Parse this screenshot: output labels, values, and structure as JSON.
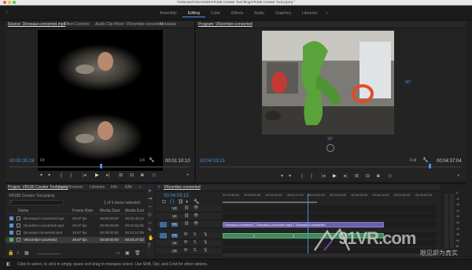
{
  "titlebar": {
    "path": "/Volumes/ASSASSIN/VR180 Creator Tool Blog/VR180 Creator Tool.prproj *"
  },
  "workspaces": [
    "Assembly",
    "Editing",
    "Color",
    "Effects",
    "Audio",
    "Graphics",
    "Libraries"
  ],
  "active_workspace": "Editing",
  "source_panel": {
    "tabs": [
      "Source: Dinosaur-converted.mp4",
      "Effect Controls",
      "Audio Clip Mixer: VRzombie-converted",
      "Metadata"
    ],
    "timecode_in": "00:00:35:26",
    "fit": "Fit",
    "timecode_dur": "00:01:10:10",
    "resolution": "1/4"
  },
  "program_panel": {
    "tab": "Program: VRzombie-converted",
    "rot_right": "90°",
    "rot_bottom": "30°",
    "timecode_in": "00:04:03:15",
    "fit": "Full",
    "timecode_dur": "00:04:37:04"
  },
  "project_panel": {
    "tabs": [
      "Project: VR180 Creator Tool.prproj",
      "Media Browser",
      "Libraries",
      "Info",
      "Effe"
    ],
    "subtitle": "VR180 Creator Tool.prproj",
    "count": "1 of 5 items selected",
    "columns": [
      "Name",
      "Frame Rate",
      "Media Start",
      "Media End"
    ],
    "rows": [
      {
        "name": "Dinosaur2-converted.mp4",
        "fps": "29.97 fps",
        "start": "00:00:00:00",
        "end": "00:02:33:14",
        "color": "#5a8fd6",
        "selected": false
      },
      {
        "name": "Dinodisco-converted.mp4",
        "fps": "29.97 fps",
        "start": "00:00:00:00",
        "end": "00:01:52:05",
        "color": "#5a8fd6",
        "selected": false
      },
      {
        "name": "Dinosaur-converted.mp4",
        "fps": "29.97 fps",
        "start": "00:00:00:00",
        "end": "00:01:10:09",
        "color": "#5a8fd6",
        "selected": false
      },
      {
        "name": "VRzombie-converted",
        "fps": "29.97 fps",
        "start": "00:00:00:00",
        "end": "00:04:37:03",
        "color": "#4ab36a",
        "selected": true
      }
    ]
  },
  "timeline": {
    "tab": "VRzombie-converted",
    "timecode": "00:04:03:15",
    "ruler": [
      "00:03:48:00",
      "00:03:56:00",
      "00:04:04:00",
      "00:04:12:00",
      "00:04:20:00",
      "00:04:28:00",
      "00:04:36:00",
      "00:04:44:00",
      "00:04:52:00",
      "00:05:00:00"
    ],
    "tracks": [
      "V3",
      "V2",
      "V1",
      "A1",
      "A2",
      "A3"
    ],
    "clip_labels": [
      "Dinosaur-converted.mp4 [V]",
      "Dinodisco-converted.mp4 [V]",
      "Dinosaur2-converted.mp4 [V]"
    ],
    "audio_scale": [
      "-6",
      "-12",
      "-18",
      "-24",
      "-30",
      "-36",
      "-42",
      "-48",
      "-54",
      "dB"
    ]
  },
  "status": {
    "text": "Click to select, or click in empty space and drag to marquee select. Use Shift, Opt, and Cmd for other options."
  },
  "watermark": {
    "brand": "91VR.com",
    "slogan": "眼见即为真实"
  }
}
